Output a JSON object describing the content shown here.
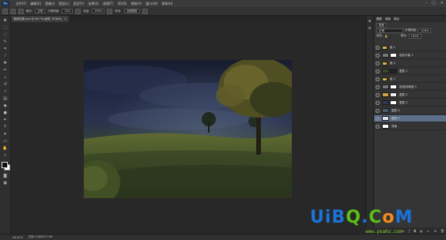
{
  "app": {
    "logo": "Ps"
  },
  "menu": [
    "文件(F)",
    "编辑(E)",
    "图像(I)",
    "图层(L)",
    "类型(Y)",
    "选择(S)",
    "滤镜(T)",
    "3D(D)",
    "视图(V)",
    "窗口(W)",
    "帮助(H)"
  ],
  "options_bar": {
    "mode_label": "模式:",
    "mode_value": "正常",
    "opacity_label": "不透明度:",
    "opacity_value": "10%",
    "flow_label": "流量:",
    "flow_value": "100%",
    "sample_label": "样本:",
    "sample_value": "当前图层"
  },
  "document_tab": {
    "title": "晚景效果.psd @ 66.7%(画笔, RGB/8)",
    "close": "×"
  },
  "status_bar": {
    "zoom": "66.67%",
    "doc_info": "文档:4.08M/72.3M"
  },
  "layers_panel": {
    "tabs": [
      "图层",
      "通道",
      "路径"
    ],
    "kind_label": "类型",
    "blend_mode": "正常",
    "opacity_label": "不透明度:",
    "opacity_value": "100%",
    "lock_label": "锁定:",
    "fill_label": "填充:",
    "fill_value": "100%",
    "layers": [
      {
        "name": "组 1",
        "type": "folder"
      },
      {
        "name": "色彩平衡 1",
        "type": "adjustment"
      },
      {
        "name": "组 2",
        "type": "folder"
      },
      {
        "name": "图层 1",
        "type": "layer"
      },
      {
        "name": "组 3",
        "type": "folder"
      },
      {
        "name": "色相/饱和度 1",
        "type": "adjustment"
      },
      {
        "name": "图层 2",
        "type": "layer"
      },
      {
        "name": "图层 3",
        "type": "layer"
      },
      {
        "name": "图层 4",
        "type": "layer"
      },
      {
        "name": "图层 5",
        "type": "layer",
        "selected": true
      },
      {
        "name": "背景",
        "type": "background"
      }
    ]
  },
  "watermark": {
    "logo_text": "UiBQ.CoM",
    "url": "www.psahz.com",
    "colors": {
      "blue": "#1a73d9",
      "green": "#5bbf1a",
      "orange": "#f28c1c"
    }
  }
}
